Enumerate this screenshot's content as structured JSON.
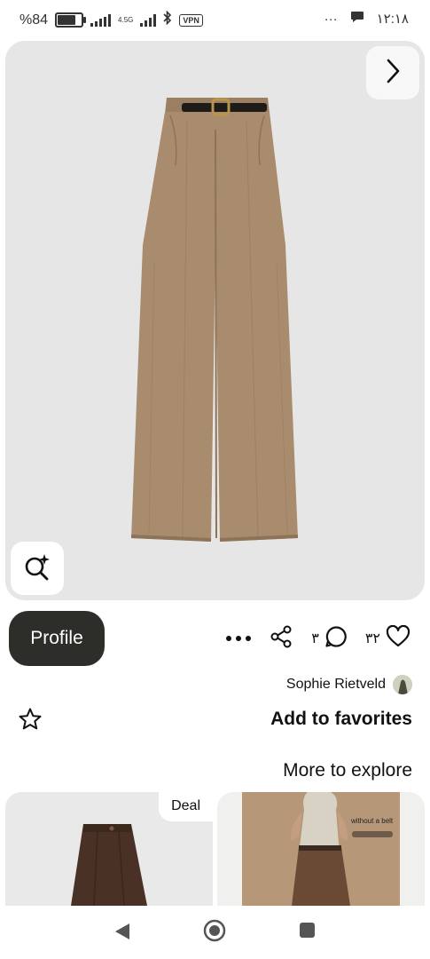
{
  "status_bar": {
    "battery": "%84",
    "battery_level": 84,
    "network": "4.5G",
    "vpn": "VPN",
    "overflow": "···",
    "time": "۱۲:۱۸"
  },
  "hero": {
    "next_icon": "chevron-right-icon",
    "lens_icon": "visual-search-icon"
  },
  "actions": {
    "profile_label": "Profile",
    "comment_count": "۳",
    "like_count": "۳۲"
  },
  "owner": {
    "name": "Sophie Rietveld"
  },
  "favorites": {
    "label": "Add to favorites"
  },
  "explore": {
    "title": "More to explore"
  },
  "tiles": [
    {
      "badge": "Deal"
    },
    {
      "overlay_text": "without a belt"
    }
  ],
  "colors": {
    "hero_bg": "#e6e6e6",
    "profile_bg": "#2d2d2a",
    "pants_tan": "#a98c6e"
  }
}
